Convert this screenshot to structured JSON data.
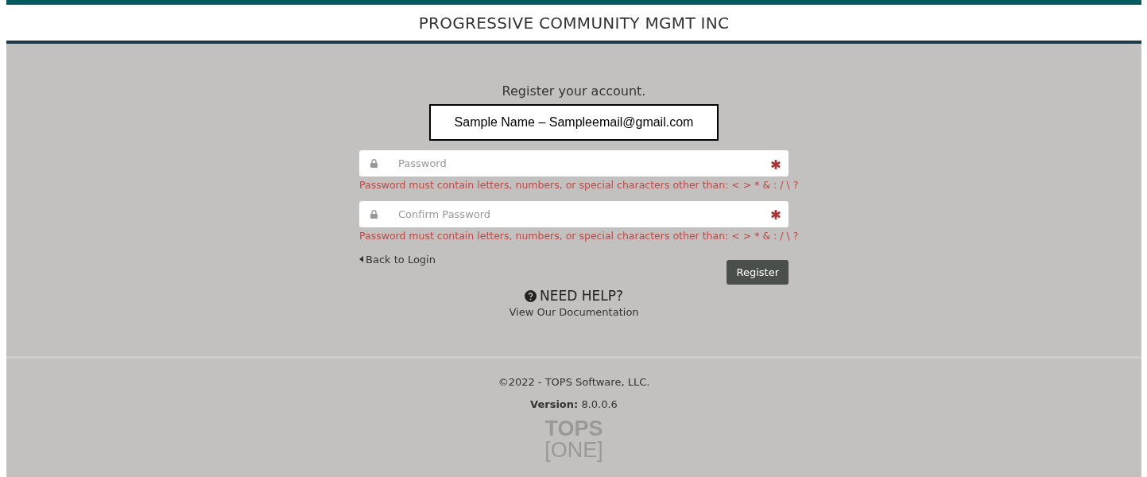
{
  "header": {
    "title": "PROGRESSIVE COMMUNITY MGMT INC"
  },
  "form": {
    "heading": "Register your account.",
    "account": "Sample Name – Sampleemail@gmail.com",
    "fields": [
      {
        "placeholder": "Password",
        "required": true,
        "error": "Password must contain letters, numbers, or special characters other than: < > * & : / \\ ?"
      },
      {
        "placeholder": "Confirm Password",
        "required": true,
        "error": "Password must contain letters, numbers, or special characters other than: < > * & : / \\ ?"
      }
    ],
    "back_link": "Back to Login",
    "submit": "Register"
  },
  "help": {
    "title": "NEED HELP?",
    "link": "View Our Documentation"
  },
  "footer": {
    "copyright": "©2022 - TOPS Software, LLC.",
    "version_label": "Version:",
    "version": "8.0.0.6",
    "logo_top": "TOPS",
    "logo_bottom": "[ONE]"
  }
}
